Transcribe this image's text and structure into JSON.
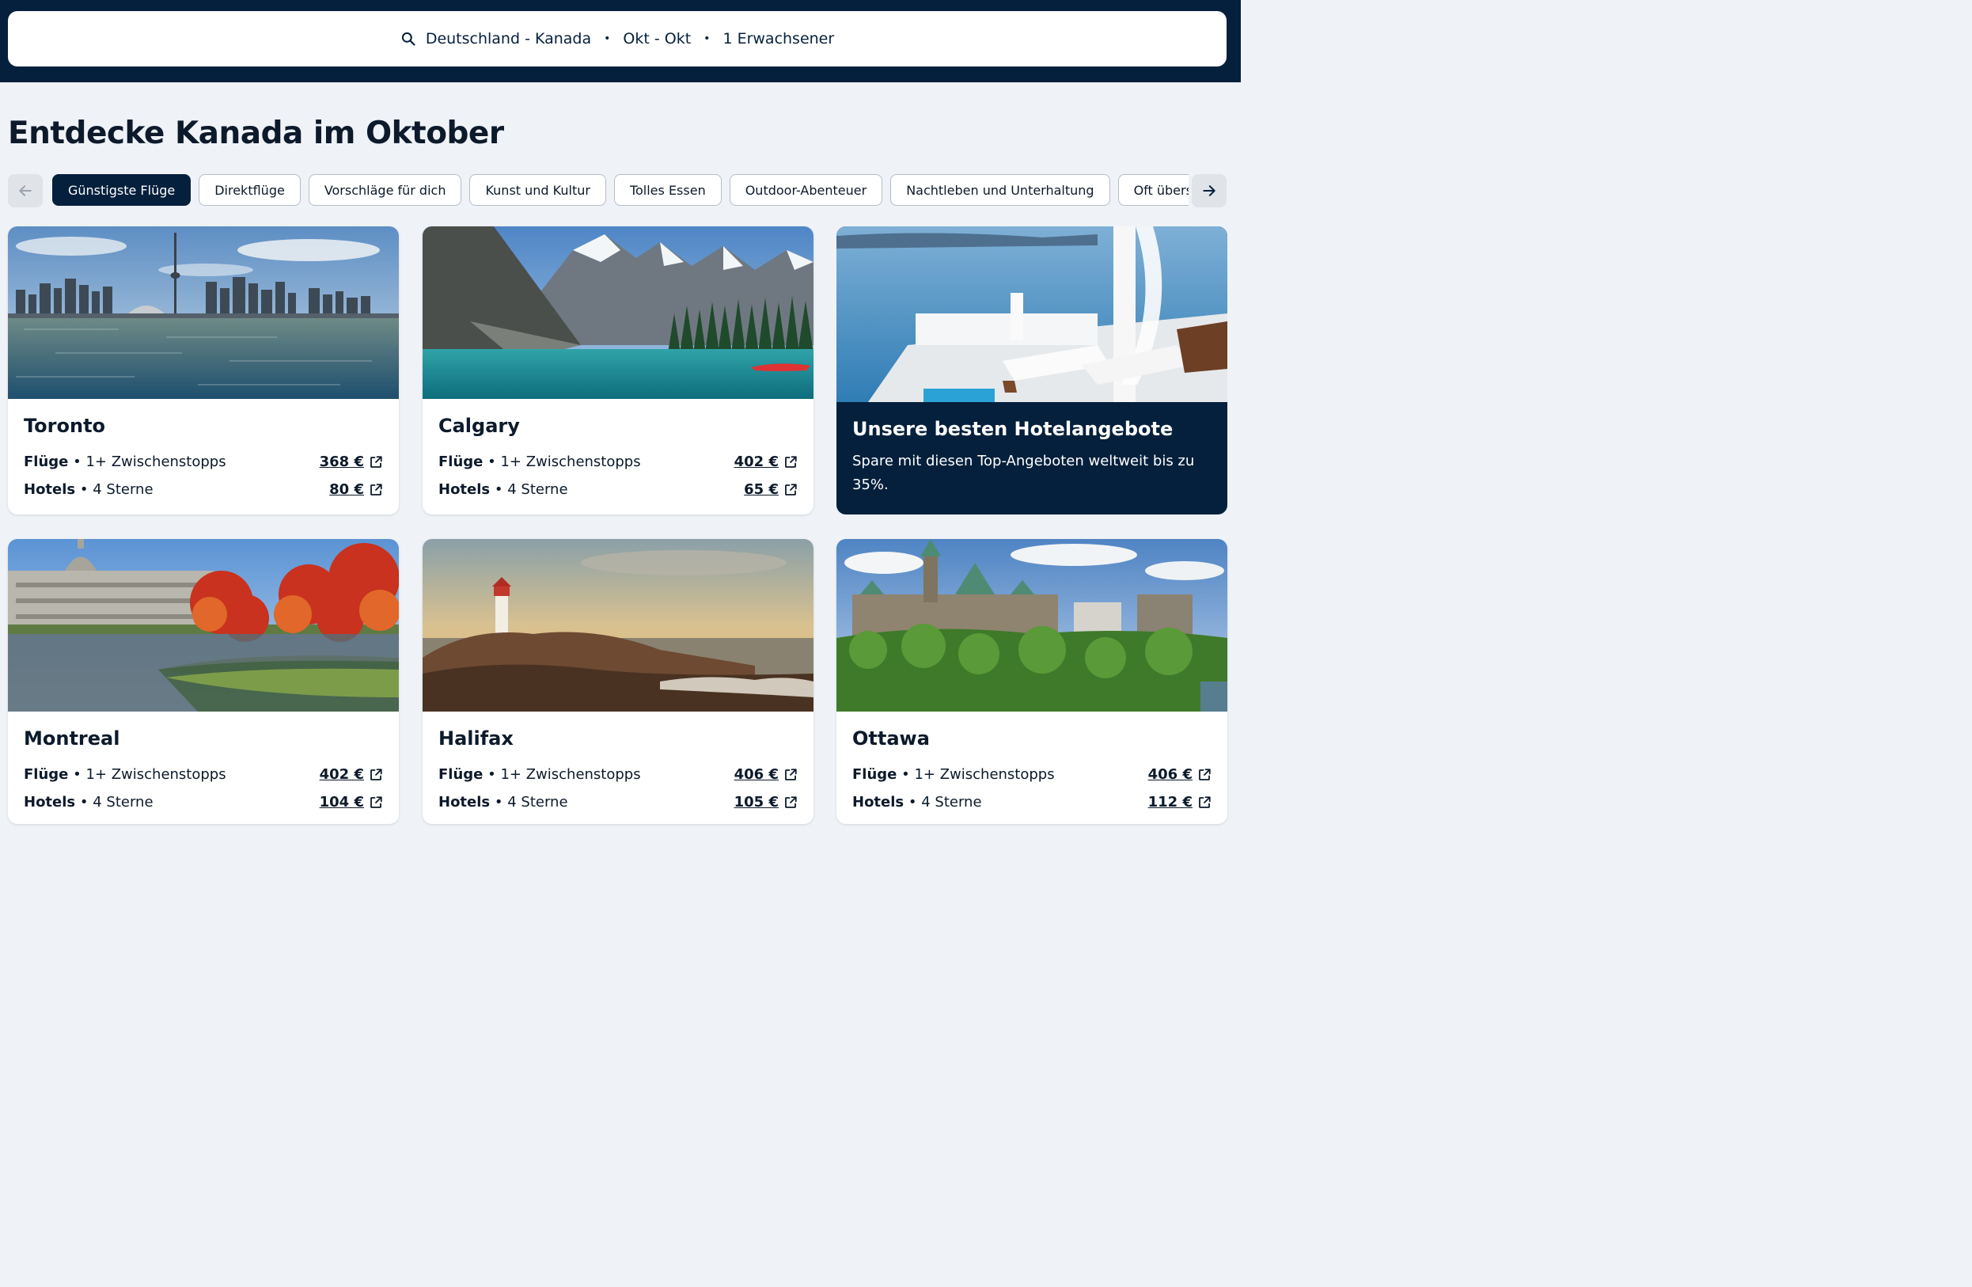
{
  "search": {
    "route": "Deutschland - Kanada",
    "dates": "Okt - Okt",
    "travellers": "1 Erwachsener",
    "separator": "•"
  },
  "page": {
    "title": "Entdecke Kanada im Oktober"
  },
  "chips": [
    "Günstigste Flüge",
    "Direktflüge",
    "Vorschläge für dich",
    "Kunst und Kultur",
    "Tolles Essen",
    "Outdoor-Abenteuer",
    "Nachtleben und Unterhaltung",
    "Oft übersehen"
  ],
  "active_chip_index": 0,
  "labels": {
    "flights": "Flüge",
    "stops": "• 1+ Zwischenstopps",
    "hotels": "Hotels",
    "stars": "• 4 Sterne"
  },
  "destinations": [
    {
      "city": "Toronto",
      "flight_price": "368 €",
      "hotel_price": "80 €"
    },
    {
      "city": "Calgary",
      "flight_price": "402 €",
      "hotel_price": "65 €"
    },
    {
      "city": "Montreal",
      "flight_price": "402 €",
      "hotel_price": "104 €"
    },
    {
      "city": "Halifax",
      "flight_price": "406 €",
      "hotel_price": "105 €"
    },
    {
      "city": "Ottawa",
      "flight_price": "406 €",
      "hotel_price": "112 €"
    }
  ],
  "promo": {
    "title": "Unsere besten Hotelangebote",
    "subtitle": "Spare mit diesen Top-Angeboten weltweit bis zu 35%."
  },
  "colors": {
    "navy": "#05203c",
    "background": "#eff3f8",
    "chip_border": "#b7bdc5"
  }
}
